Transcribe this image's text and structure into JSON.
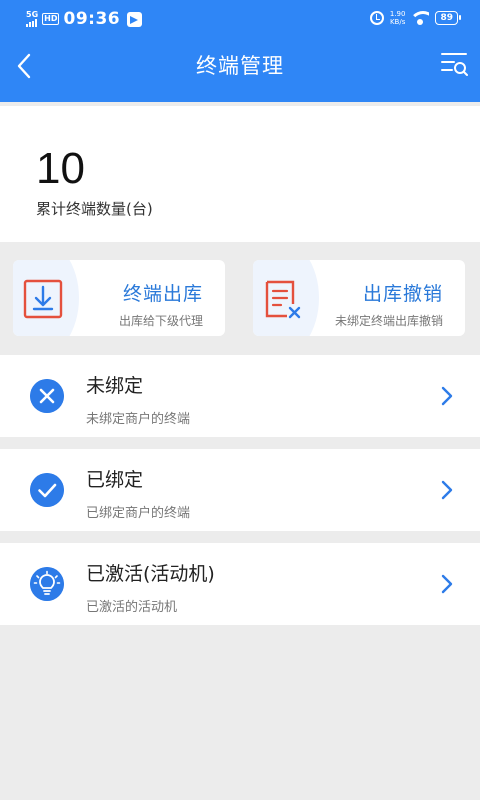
{
  "status_bar": {
    "network": "5G",
    "hd": "HD",
    "time": "09:36",
    "speed_value": "1.90",
    "speed_unit": "KB/s",
    "battery": "89"
  },
  "header": {
    "title": "终端管理",
    "back_icon": "chevron-left-icon",
    "menu_icon": "list-search-icon",
    "color": "#2f86f6"
  },
  "summary": {
    "count": "10",
    "label": "累计终端数量(台)"
  },
  "actions": [
    {
      "title": "终端出库",
      "subtitle": "出库给下级代理",
      "icon": "download-box-icon"
    },
    {
      "title": "出库撤销",
      "subtitle": "未绑定终端出库撤销",
      "icon": "document-cancel-icon"
    }
  ],
  "list": [
    {
      "title": "未绑定",
      "subtitle": "未绑定商户的终端",
      "icon": "close-circle-icon"
    },
    {
      "title": "已绑定",
      "subtitle": "已绑定商户的终端",
      "icon": "check-circle-icon"
    },
    {
      "title": "已激活(活动机)",
      "subtitle": "已激活的活动机",
      "icon": "lightbulb-icon"
    }
  ],
  "colors": {
    "accent": "#2f86f6",
    "action_text": "#2a79d9",
    "icon_red": "#e4503d",
    "icon_blue": "#2d7be8"
  }
}
